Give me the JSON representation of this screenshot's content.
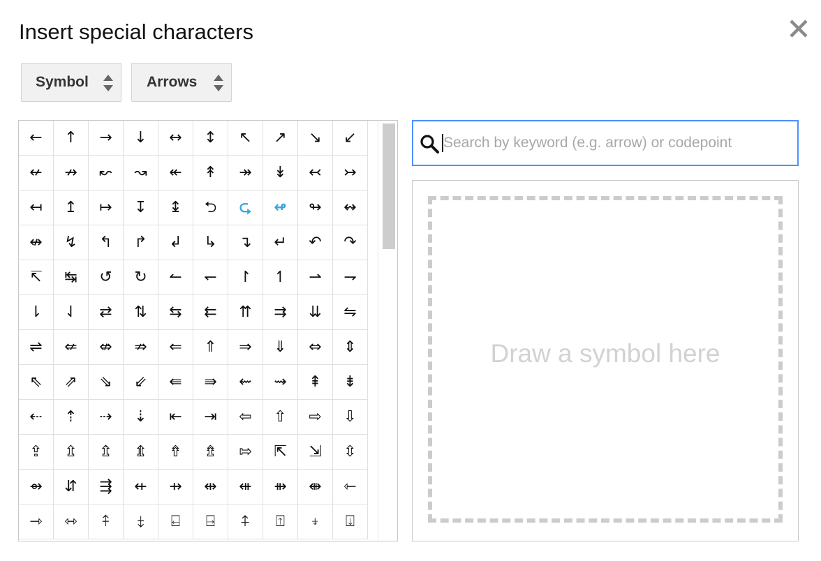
{
  "dialog": {
    "title": "Insert special characters"
  },
  "icons": {
    "close": "close-icon",
    "updown": "updown-arrows-icon",
    "search": "search-icon"
  },
  "selectors": {
    "category": "Symbol",
    "subcategory": "Arrows"
  },
  "search": {
    "value": "",
    "placeholder": "Search by keyword (e.g. arrow) or codepoint"
  },
  "draw": {
    "hint": "Draw a symbol here"
  },
  "colors": {
    "accent": "#4d90fe",
    "highlight_symbol": "#3aa7dc"
  },
  "grid": {
    "highlighted": [
      26,
      27
    ],
    "symbols": [
      "←",
      "↑",
      "→",
      "↓",
      "↔",
      "↕",
      "↖",
      "↗",
      "↘",
      "↙",
      "↚",
      "↛",
      "↜",
      "↝",
      "↞",
      "↟",
      "↠",
      "↡",
      "↢",
      "↣",
      "↤",
      "↥",
      "↦",
      "↧",
      "↨",
      "⮌",
      "⮎",
      "↫",
      "↬",
      "↭",
      "↮",
      "↯",
      "↰",
      "↱",
      "↲",
      "↳",
      "↴",
      "↵",
      "↶",
      "↷",
      "↸",
      "↹",
      "↺",
      "↻",
      "↼",
      "↽",
      "↾",
      "↿",
      "⇀",
      "⇁",
      "⇂",
      "⇃",
      "⇄",
      "⇅",
      "⇆",
      "⇇",
      "⇈",
      "⇉",
      "⇊",
      "⇋",
      "⇌",
      "⇍",
      "⇎",
      "⇏",
      "⇐",
      "⇑",
      "⇒",
      "⇓",
      "⇔",
      "⇕",
      "⇖",
      "⇗",
      "⇘",
      "⇙",
      "⇚",
      "⇛",
      "⇜",
      "⇝",
      "⇞",
      "⇟",
      "⇠",
      "⇡",
      "⇢",
      "⇣",
      "⇤",
      "⇥",
      "⇦",
      "⇧",
      "⇨",
      "⇩",
      "⇪",
      "⇫",
      "⇬",
      "⇭",
      "⇮",
      "⇯",
      "⇰",
      "⇱",
      "⇲",
      "⇳",
      "⇴",
      "⇵",
      "⇶",
      "⇷",
      "⇸",
      "⇹",
      "⇺",
      "⇻",
      "⇼",
      "⇽",
      "⇾",
      "⇿",
      "⤉",
      "⤈",
      "⍇",
      "⍈",
      "⍏",
      "⍐",
      "⍖",
      "⍗"
    ]
  }
}
